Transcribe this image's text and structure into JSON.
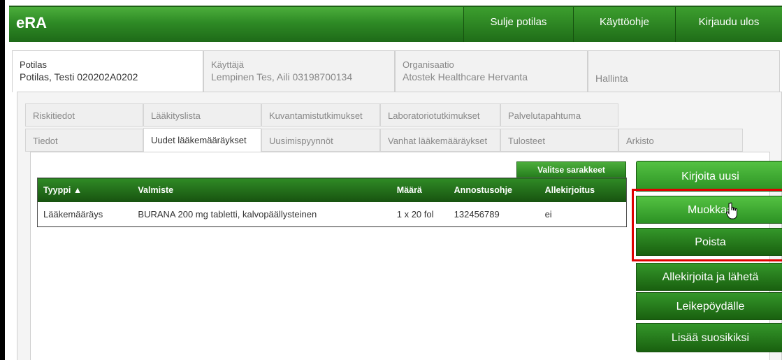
{
  "header": {
    "logo": "eRA",
    "buttons": [
      "Sulje potilas",
      "Käyttöohje",
      "Kirjaudu ulos"
    ]
  },
  "top_tabs": [
    {
      "label": "Potilas",
      "value": "Potilas, Testi 020202A0202"
    },
    {
      "label": "Käyttäjä",
      "value": "Lempinen Tes, Aili 03198700134"
    },
    {
      "label": "Organisaatio",
      "value": "Atostek Healthcare Hervanta"
    },
    {
      "label": "",
      "value": "Hallinta"
    }
  ],
  "sub_tabs_row1": [
    "Riskitiedot",
    "Lääkityslista",
    "Kuvantamistutkimukset",
    "Laboratoriotutkimukset",
    "Palvelutapahtuma"
  ],
  "sub_tabs_row2": [
    "Tiedot",
    "Uudet lääkemääräykset",
    "Uusimispyynnöt",
    "Vanhat lääkemääräykset",
    "Tulosteet",
    "Arkisto"
  ],
  "select_columns": "Valitse sarakkeet",
  "table": {
    "headers": [
      "Tyyppi ▲",
      "Valmiste",
      "Määrä",
      "Annostusohje",
      "Allekirjoitus"
    ],
    "rows": [
      [
        "Lääkemääräys",
        "BURANA 200 mg tabletti, kalvopäällysteinen",
        "1 x 20 fol",
        "132456789",
        "ei"
      ]
    ]
  },
  "actions": {
    "kirjoita_uusi": "Kirjoita uusi",
    "muokkaa": "Muokkaa",
    "poista": "Poista",
    "allekirjoita": "Allekirjoita ja lähetä",
    "leikepoydalle": "Leikepöydälle",
    "lisaa_suosikiksi": "Lisää suosikiksi"
  },
  "colors": {
    "primary_green": "#2e8a25",
    "highlight_red": "#e00000"
  }
}
